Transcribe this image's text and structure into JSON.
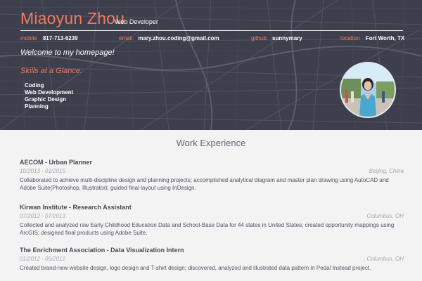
{
  "header": {
    "name": "Miaoyun Zhou",
    "role": "Web Developer",
    "contact": [
      {
        "label": "mobile",
        "value": "817-713-6239"
      },
      {
        "label": "email",
        "value": "mary.zhou.coding@gmail.com"
      },
      {
        "label": "github",
        "value": "sunnymary"
      },
      {
        "label": "location",
        "value": "Fort Worth, TX"
      }
    ],
    "welcome": "Welcome to my homepage!",
    "skills_title": "Skills at a Glance:",
    "skills": [
      "Coding",
      "Web Development",
      "Graphic Design",
      "Planning"
    ]
  },
  "work": {
    "section_title": "Work Experience",
    "jobs": [
      {
        "title": "AECOM - Urban Planner",
        "dates": "10/2013 - 01/2015",
        "location": "Beijing, China",
        "description": "Collaborated to achieve multi-discipline design and planning projects; accomplished analytical diagram and master plan drawing using AutoCAD and Adobe Suite(Photoshop, Illustrator); guided final layout using InDesign."
      },
      {
        "title": "Kirwan Institute - Research Assistant",
        "dates": "07/2012 - 07/2013",
        "location": "Columbus, OH",
        "description": "Collected and analyzed raw Early Childhood Education Data and School-Base Data for 44 states in United States; created opportunity mappings using ArcGIS; designed final products using Adobe Suite."
      },
      {
        "title": "The Enrichment Association - Data Visualization Intern",
        "dates": "01/2012 - 05/2012",
        "location": "Columbus, OH",
        "description": "Created brand-new website design, logo design and T-shirt design; discovered, analyzed and illustrated data pattern in Pedal Instead project."
      }
    ]
  },
  "colors": {
    "accent": "#f07a5e",
    "hero_bg": "#3e3f4c",
    "page_bg": "#f3f3f3",
    "heading": "#626771",
    "meta": "#a5a9b1"
  }
}
